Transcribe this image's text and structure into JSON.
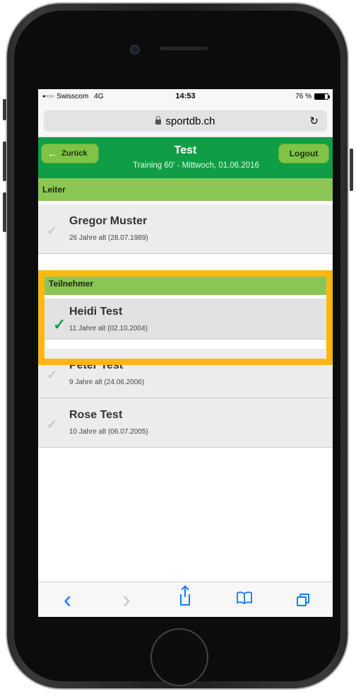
{
  "status_bar": {
    "signal": "●○○○○",
    "carrier": "Swisscom",
    "network": "4G",
    "time": "14:53",
    "battery_text": "76 %",
    "battery_level": 0.76
  },
  "browser": {
    "url": "sportdb.ch",
    "reload_icon": "reload-icon"
  },
  "header": {
    "back_label": "Zurück",
    "title": "Test",
    "subtitle": "Training 60' - Mittwoch, 01.06.2016",
    "logout_label": "Logout"
  },
  "sections": {
    "leiter": "Leiter",
    "teilnehmer": "Teilnehmer"
  },
  "leiter": [
    {
      "name": "Gregor Muster",
      "age": "26 Jahre alt (28.07.1989)",
      "checked": false
    }
  ],
  "teilnehmer": [
    {
      "name": "Heidi Test",
      "age": "11 Jahre alt (02.10.2004)",
      "checked": true
    },
    {
      "name": "Peter Test",
      "age": "9 Jahre alt (24.06.2006)",
      "checked": false
    },
    {
      "name": "Rose Test",
      "age": "10 Jahre alt (06.07.2005)",
      "checked": false
    }
  ],
  "toolbar": {
    "back_icon": "‹",
    "forward_icon": "›",
    "bookmarks_icon": "📖"
  },
  "colors": {
    "header_green": "#0f9e45",
    "section_green": "#8bc655",
    "button_green": "#7fc447",
    "highlight": "#fcb712",
    "check_active": "#1c9e4a"
  }
}
